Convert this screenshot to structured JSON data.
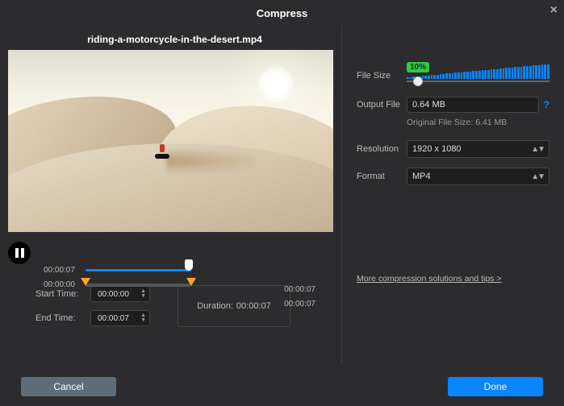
{
  "header": {
    "title": "Compress"
  },
  "file": {
    "name": "riding-a-motorcycle-in-the-desert.mp4"
  },
  "playback": {
    "current": "00:00:07",
    "total": "00:00:07",
    "range_start": "00:00:00",
    "range_end": "00:00:07"
  },
  "time": {
    "start_label": "Start Time:",
    "end_label": "End Time:",
    "start_value": "00:00:00",
    "end_value": "00:00:07",
    "duration_label": "Duration:",
    "duration_value": "00:00:07"
  },
  "compress": {
    "filesize_label": "File Size",
    "filesize_percent": "10%",
    "output_label": "Output File",
    "output_value": "0.64  MB",
    "original_label": "Original File Size: 6.41 MB",
    "resolution_label": "Resolution",
    "resolution_value": "1920 x 1080",
    "format_label": "Format",
    "format_value": "MP4",
    "more_link": "More compression solutions and tips >"
  },
  "buttons": {
    "cancel": "Cancel",
    "done": "Done"
  }
}
